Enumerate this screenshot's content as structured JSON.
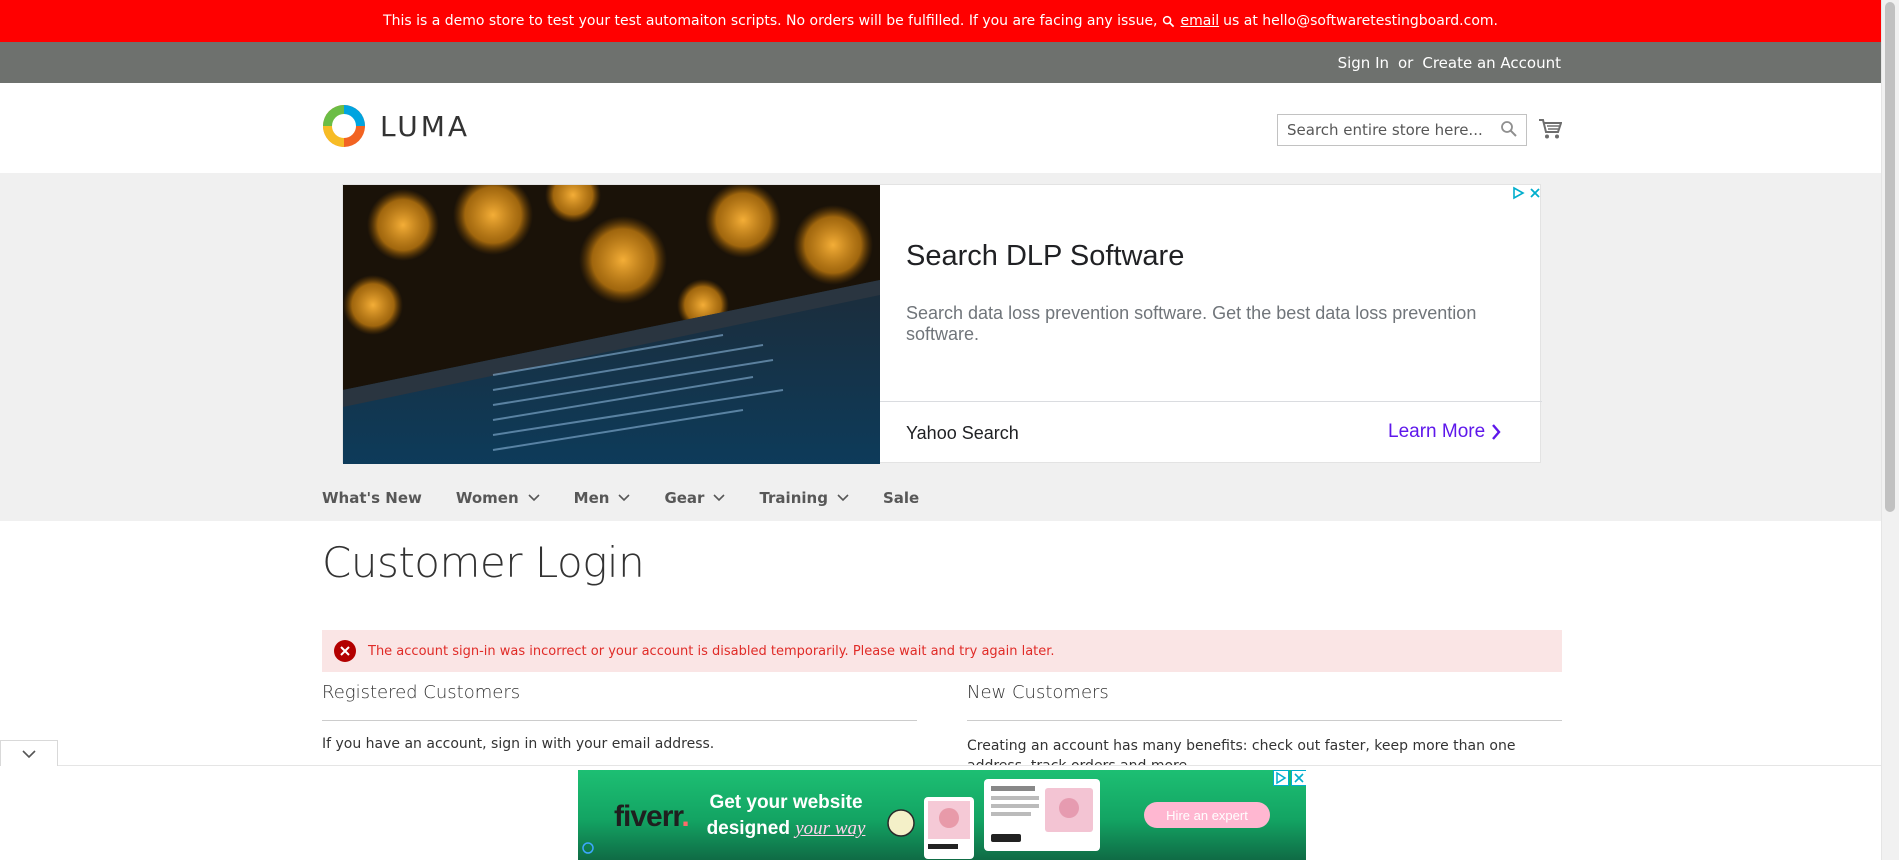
{
  "notice": {
    "text_before": "This is a demo store to test your test automaiton scripts. No orders will be fulfilled. If you are facing any issue,",
    "link": "email",
    "text_after": "us at hello@softwaretestingboard.com."
  },
  "header": {
    "sign_in": "Sign In",
    "or": "or",
    "create_account": "Create an Account",
    "logo_text": "LUMA",
    "search_placeholder": "Search entire store here..."
  },
  "ad": {
    "title": "Search DLP Software",
    "description": "Search data loss prevention software. Get the best data loss prevention software.",
    "source": "Yahoo Search",
    "cta": "Learn More"
  },
  "nav": {
    "items": [
      {
        "label": "What's New",
        "dropdown": false
      },
      {
        "label": "Women",
        "dropdown": true
      },
      {
        "label": "Men",
        "dropdown": true
      },
      {
        "label": "Gear",
        "dropdown": true
      },
      {
        "label": "Training",
        "dropdown": true
      },
      {
        "label": "Sale",
        "dropdown": false
      }
    ]
  },
  "main": {
    "title": "Customer Login",
    "error": "The account sign-in was incorrect or your account is disabled temporarily. Please wait and try again later.",
    "registered": {
      "title": "Registered Customers",
      "text": "If you have an account, sign in with your email address."
    },
    "new": {
      "title": "New Customers",
      "text": "Creating an account has many benefits: check out faster, keep more than one address, track orders and more."
    }
  },
  "banner": {
    "logo": "fiverr",
    "headline_line1": "Get your website",
    "headline_word": "designed",
    "headline_em": "your way",
    "button": "Hire an expert"
  },
  "colors": {
    "notice_bg": "#ff0000",
    "panel_bg": "#6e716e",
    "error_text": "#e02b27",
    "error_bg": "#fae5e5",
    "ad_cta": "#5e17eb"
  }
}
